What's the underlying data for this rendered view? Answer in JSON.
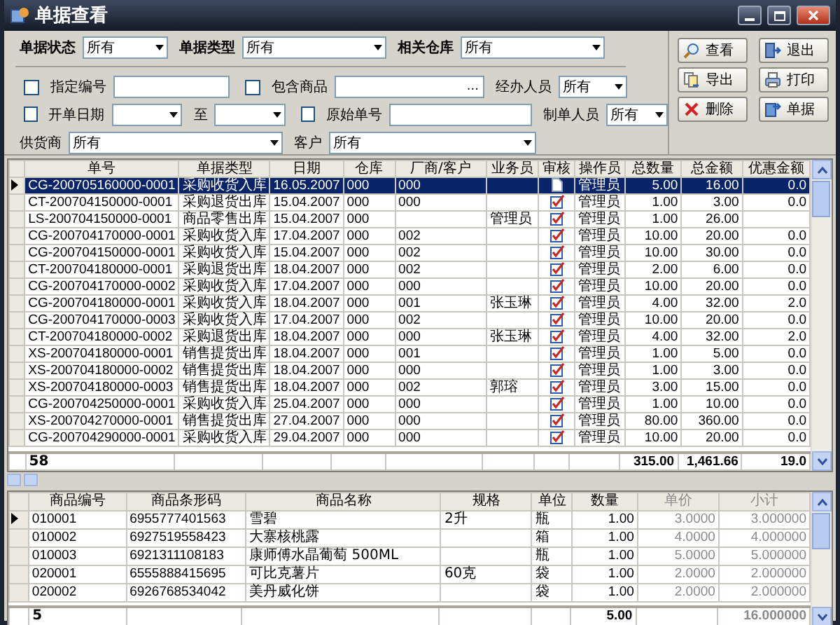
{
  "window": {
    "title": "单据查看"
  },
  "filter_rows": [
    {
      "kind": "main",
      "items": [
        {
          "kind": "select",
          "label": "单据状态",
          "value": "所有"
        },
        {
          "kind": "select",
          "label": "单据类型",
          "value": "所有"
        },
        {
          "kind": "select",
          "label": "相关仓库",
          "value": "所有"
        }
      ]
    },
    {
      "kind": "detail",
      "items": [
        {
          "kind": "check_input",
          "label": "指定编号",
          "checked": false
        },
        {
          "kind": "check_browse",
          "label": "包含商品",
          "checked": false,
          "button": "..."
        },
        {
          "kind": "select",
          "label": "经办人员",
          "value": "所有"
        }
      ]
    },
    {
      "kind": "detail",
      "items": [
        {
          "kind": "check_select",
          "label": "开单日期",
          "checked": false
        },
        {
          "kind": "select",
          "label": "至"
        },
        {
          "kind": "check_input",
          "label": "原始单号",
          "checked": false
        },
        {
          "kind": "select",
          "label": "制单人员",
          "value": "所有"
        }
      ]
    },
    {
      "kind": "detail",
      "items": [
        {
          "kind": "select",
          "label": "供货商",
          "value": "所有"
        },
        {
          "kind": "select",
          "label": "客户",
          "value": "所有"
        }
      ]
    }
  ],
  "buttons": [
    {
      "label": "查看",
      "kind": "search"
    },
    {
      "label": "退出",
      "kind": "exit"
    },
    {
      "label": "导出",
      "kind": "export"
    },
    {
      "label": "打印",
      "kind": "print"
    },
    {
      "label": "删除",
      "kind": "delete"
    },
    {
      "label": "单据",
      "kind": "document"
    }
  ],
  "documents": {
    "focused": true,
    "columns": [
      {
        "label": "单号",
        "kind": "code",
        "total": "58"
      },
      {
        "label": "单据类型",
        "kind": "text"
      },
      {
        "label": "日期",
        "kind": "code"
      },
      {
        "label": "仓库",
        "kind": "code"
      },
      {
        "label": "厂商/客户",
        "kind": "code"
      },
      {
        "label": "业务员",
        "kind": "text"
      },
      {
        "label": "审核",
        "kind": "icon"
      },
      {
        "label": "操作员",
        "kind": "text"
      },
      {
        "label": "总数量",
        "kind": "number",
        "total": "315.00"
      },
      {
        "label": "总金额",
        "kind": "number",
        "total": "1,461.66"
      },
      {
        "label": "优惠金额",
        "kind": "number",
        "total": "19.0"
      }
    ],
    "rows": [
      {
        "selected": true,
        "reviewed": false,
        "cells": [
          "CG-200705160000-0001",
          "采购收货入库",
          "16.05.2007",
          "000",
          "000",
          null,
          null,
          "管理员",
          "5.00",
          "16.00",
          "0.0"
        ]
      },
      {
        "selected": false,
        "reviewed": true,
        "cells": [
          "CT-200704150000-0001",
          "采购退货出库",
          "15.04.2007",
          "000",
          "000",
          null,
          null,
          "管理员",
          "1.00",
          "3.00",
          "0.0"
        ]
      },
      {
        "selected": false,
        "reviewed": true,
        "cells": [
          "LS-200704150000-0001",
          "商品零售出库",
          "15.04.2007",
          "000",
          null,
          "管理员",
          null,
          "管理员",
          "1.00",
          "26.00",
          null
        ]
      },
      {
        "selected": false,
        "reviewed": true,
        "cells": [
          "CG-200704170000-0001",
          "采购收货入库",
          "17.04.2007",
          "000",
          "002",
          null,
          null,
          "管理员",
          "10.00",
          "20.00",
          "0.0"
        ]
      },
      {
        "selected": false,
        "reviewed": true,
        "cells": [
          "CG-200704150000-0001",
          "采购收货入库",
          "15.04.2007",
          "000",
          "002",
          null,
          null,
          "管理员",
          "10.00",
          "30.00",
          "0.0"
        ]
      },
      {
        "selected": false,
        "reviewed": true,
        "cells": [
          "CT-200704180000-0001",
          "采购退货出库",
          "18.04.2007",
          "000",
          "002",
          null,
          null,
          "管理员",
          "2.00",
          "6.00",
          "0.0"
        ]
      },
      {
        "selected": false,
        "reviewed": true,
        "cells": [
          "CG-200704170000-0002",
          "采购收货入库",
          "17.04.2007",
          "000",
          "000",
          null,
          null,
          "管理员",
          "10.00",
          "20.00",
          "0.0"
        ]
      },
      {
        "selected": false,
        "reviewed": true,
        "cells": [
          "CG-200704180000-0001",
          "采购收货入库",
          "18.04.2007",
          "000",
          "001",
          "张玉琳",
          null,
          "管理员",
          "4.00",
          "32.00",
          "2.0"
        ]
      },
      {
        "selected": false,
        "reviewed": true,
        "cells": [
          "CG-200704170000-0003",
          "采购收货入库",
          "17.04.2007",
          "000",
          "002",
          null,
          null,
          "管理员",
          "10.00",
          "20.00",
          "0.0"
        ]
      },
      {
        "selected": false,
        "reviewed": true,
        "cells": [
          "CT-200704180000-0002",
          "采购退货出库",
          "18.04.2007",
          "000",
          "000",
          "张玉琳",
          null,
          "管理员",
          "4.00",
          "32.00",
          "2.0"
        ]
      },
      {
        "selected": false,
        "reviewed": true,
        "cells": [
          "XS-200704180000-0001",
          "销售提货出库",
          "18.04.2007",
          "000",
          "001",
          null,
          null,
          "管理员",
          "1.00",
          "5.00",
          "0.0"
        ]
      },
      {
        "selected": false,
        "reviewed": true,
        "cells": [
          "XS-200704180000-0002",
          "销售提货出库",
          "18.04.2007",
          "000",
          "000",
          null,
          null,
          "管理员",
          "1.00",
          "3.00",
          "0.0"
        ]
      },
      {
        "selected": false,
        "reviewed": true,
        "cells": [
          "XS-200704180000-0003",
          "销售提货出库",
          "18.04.2007",
          "000",
          "002",
          "郭瑢",
          null,
          "管理员",
          "3.00",
          "15.00",
          "0.0"
        ]
      },
      {
        "selected": false,
        "reviewed": true,
        "cells": [
          "CG-200704250000-0001",
          "采购收货入库",
          "25.04.2007",
          "000",
          "000",
          null,
          null,
          "管理员",
          "1.00",
          "10.00",
          "0.0"
        ]
      },
      {
        "selected": false,
        "reviewed": true,
        "cells": [
          "XS-200704270000-0001",
          "销售提货出库",
          "27.04.2007",
          "000",
          "000",
          null,
          null,
          "管理员",
          "80.00",
          "360.00",
          "0.0"
        ]
      },
      {
        "selected": false,
        "reviewed": true,
        "cells": [
          "CG-200704290000-0001",
          "采购收货入库",
          "29.04.2007",
          "000",
          "000",
          null,
          null,
          "管理员",
          "10.00",
          "20.00",
          "0.0"
        ]
      }
    ]
  },
  "items": {
    "focused": false,
    "columns": [
      {
        "label": "商品编号",
        "kind": "code",
        "total": "5"
      },
      {
        "label": "商品条形码",
        "kind": "code"
      },
      {
        "label": "商品名称",
        "kind": "text"
      },
      {
        "label": "规格",
        "kind": "text"
      },
      {
        "label": "单位",
        "kind": "text"
      },
      {
        "label": "数量",
        "kind": "number",
        "total": "5.00"
      },
      {
        "label": "单价",
        "kind": "dim"
      },
      {
        "label": "小计",
        "kind": "dim",
        "total": "16.000000"
      }
    ],
    "rows": [
      {
        "selected": true,
        "cells": [
          "010001",
          "6955777401563",
          "雪碧",
          "2升",
          "瓶",
          "1.00",
          "3.0000",
          "3.000000"
        ]
      },
      {
        "selected": false,
        "cells": [
          "010002",
          "6927519558423",
          "大寨核桃露",
          null,
          "箱",
          "1.00",
          "4.0000",
          "4.000000"
        ]
      },
      {
        "selected": false,
        "cells": [
          "010003",
          "6921311108183",
          "康师傅水晶葡萄 500ML",
          null,
          "瓶",
          "1.00",
          "5.0000",
          "5.000000"
        ]
      },
      {
        "selected": false,
        "cells": [
          "020001",
          "6555888415695",
          "可比克薯片",
          "60克",
          "袋",
          "1.00",
          "2.0000",
          "2.000000"
        ]
      },
      {
        "selected": false,
        "cells": [
          "020002",
          "6926768534042",
          "美丹威化饼",
          null,
          "袋",
          "1.00",
          "2.0000",
          "2.000000"
        ]
      }
    ]
  }
}
